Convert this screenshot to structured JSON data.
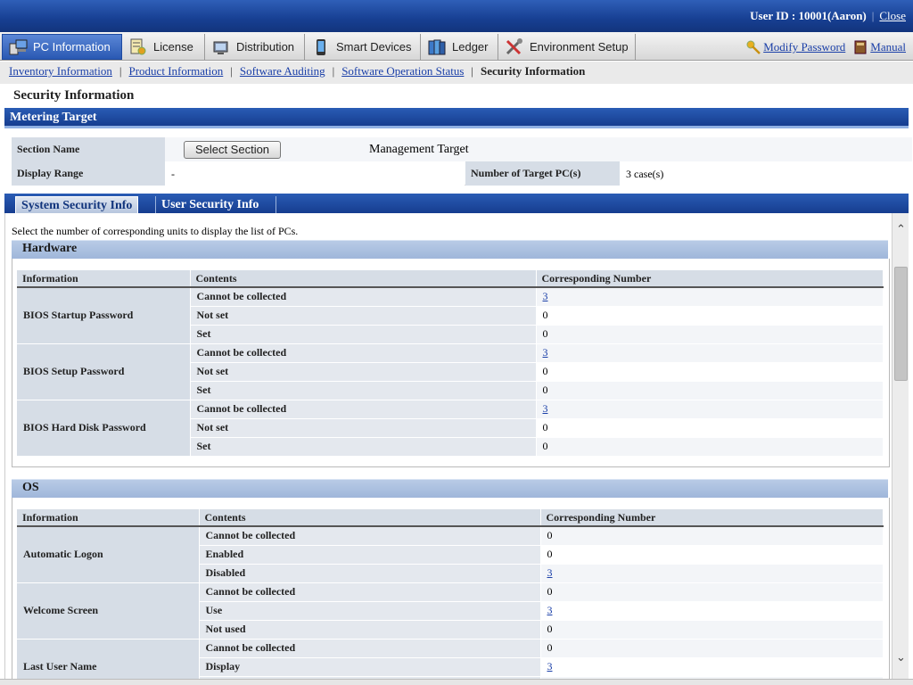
{
  "topbar": {
    "user_label": "User ID : 10001(Aaron)",
    "close_label": "Close"
  },
  "mainnav": {
    "tabs": [
      {
        "label": "PC Information",
        "icon": "pc-icon",
        "active": true
      },
      {
        "label": "License",
        "icon": "license-icon"
      },
      {
        "label": "Distribution",
        "icon": "distribution-icon"
      },
      {
        "label": "Smart Devices",
        "icon": "smart-device-icon"
      },
      {
        "label": "Ledger",
        "icon": "ledger-icon"
      },
      {
        "label": "Environment Setup",
        "icon": "tools-icon"
      }
    ],
    "modify_password": "Modify Password",
    "manual": "Manual"
  },
  "subnav": {
    "items": [
      "Inventory Information",
      "Product Information",
      "Software Auditing",
      "Software Operation Status"
    ],
    "current": "Security Information"
  },
  "page_title": "Security Information",
  "metering": {
    "header": "Metering Target",
    "section_name_label": "Section Name",
    "select_section_button": "Select Section",
    "management_target": "Management Target",
    "display_range_label": "Display Range",
    "display_range_value": "-",
    "target_pcs_label": "Number of Target PC(s)",
    "target_pcs_value": "3 case(s)"
  },
  "tabs": {
    "system": "System Security Info",
    "user": "User Security Info"
  },
  "instruction": "Select the number of corresponding units to display the list of PCs.",
  "columns": {
    "info": "Information",
    "contents": "Contents",
    "number": "Corresponding Number"
  },
  "hardware": {
    "title": "Hardware",
    "groups": [
      {
        "name": "BIOS Startup Password",
        "rows": [
          {
            "c": "Cannot be collected",
            "n": "3",
            "link": true
          },
          {
            "c": "Not set",
            "n": "0"
          },
          {
            "c": "Set",
            "n": "0"
          }
        ]
      },
      {
        "name": "BIOS Setup Password",
        "rows": [
          {
            "c": "Cannot be collected",
            "n": "3",
            "link": true
          },
          {
            "c": "Not set",
            "n": "0"
          },
          {
            "c": "Set",
            "n": "0"
          }
        ]
      },
      {
        "name": "BIOS Hard Disk Password",
        "rows": [
          {
            "c": "Cannot be collected",
            "n": "3",
            "link": true
          },
          {
            "c": "Not set",
            "n": "0"
          },
          {
            "c": "Set",
            "n": "0"
          }
        ]
      }
    ]
  },
  "os": {
    "title": "OS",
    "groups": [
      {
        "name": "Automatic Logon",
        "rows": [
          {
            "c": "Cannot be collected",
            "n": "0"
          },
          {
            "c": "Enabled",
            "n": "0"
          },
          {
            "c": "Disabled",
            "n": "3",
            "link": true
          }
        ]
      },
      {
        "name": "Welcome Screen",
        "rows": [
          {
            "c": "Cannot be collected",
            "n": "0"
          },
          {
            "c": "Use",
            "n": "3",
            "link": true
          },
          {
            "c": "Not used",
            "n": "0"
          }
        ]
      },
      {
        "name": "Last User Name",
        "rows": [
          {
            "c": "Cannot be collected",
            "n": "0"
          },
          {
            "c": "Display",
            "n": "3",
            "link": true
          },
          {
            "c": "",
            "n": ""
          }
        ]
      }
    ]
  },
  "colors": {
    "accent": "#1f4ea3",
    "link": "#1a3fa8",
    "label_bg": "#d6dde6"
  }
}
